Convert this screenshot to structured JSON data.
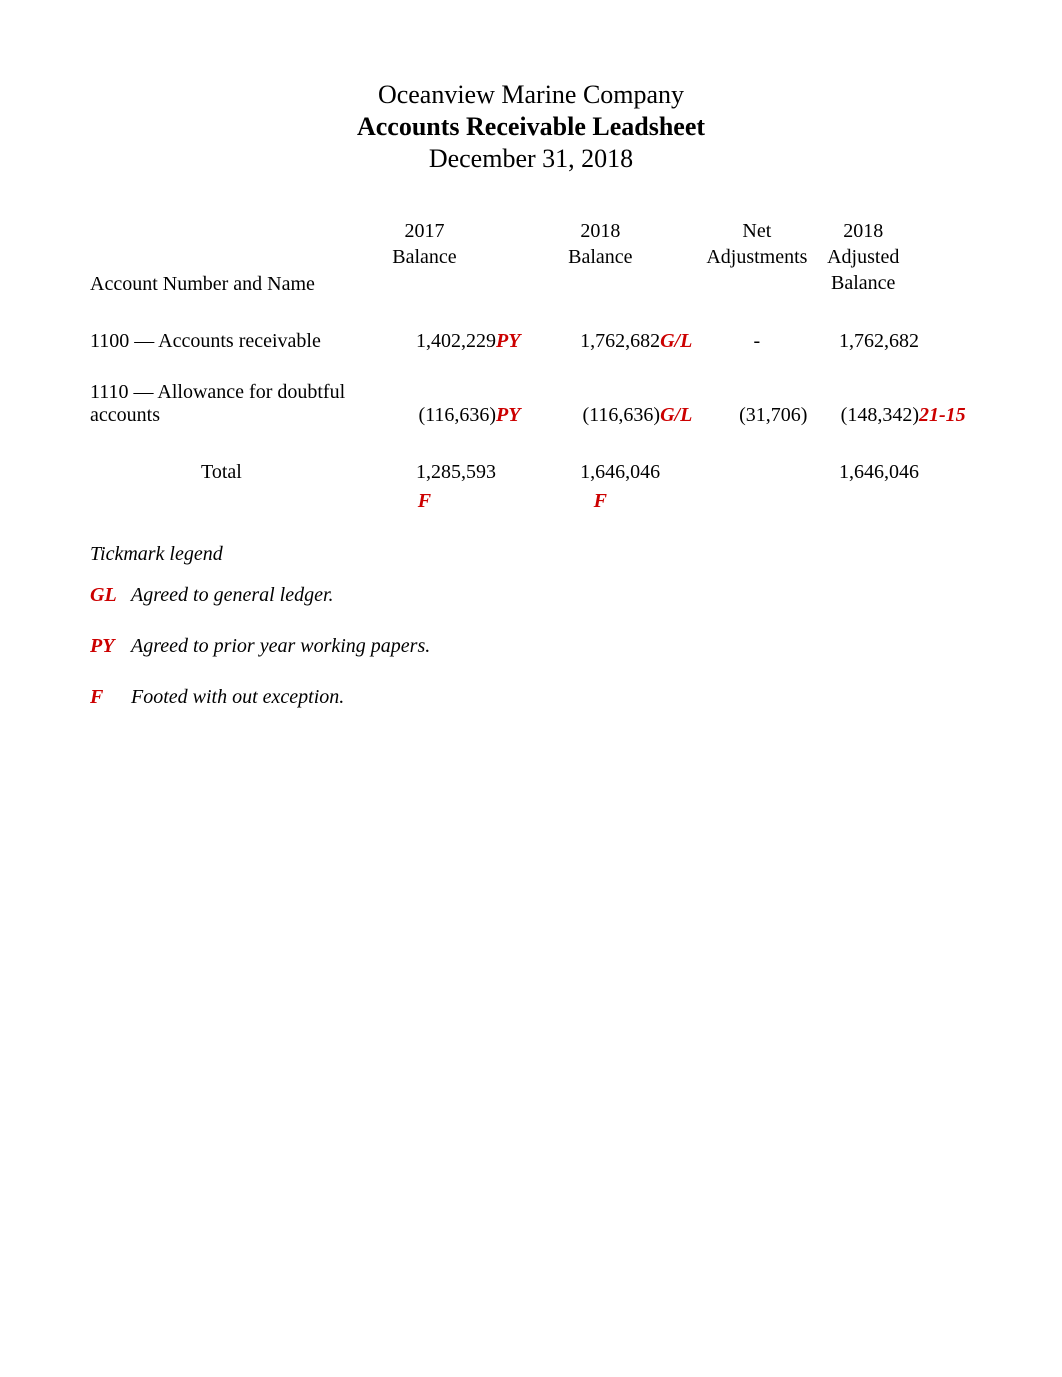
{
  "header": {
    "company": "Oceanview Marine Company",
    "title": "Accounts Receivable Leadsheet",
    "date": "December 31, 2018"
  },
  "columns": {
    "account": "Account Number and Name",
    "bal2017_line1": "2017",
    "bal2017_line2": "Balance",
    "bal2018_line1": "2018",
    "bal2018_line2": "Balance",
    "adj_line1": "Net",
    "adj_line2": "Adjustments",
    "adjbal_line1": "2018",
    "adjbal_line2": "Adjusted",
    "adjbal_line3": "Balance"
  },
  "rows": [
    {
      "name": "1100 — Accounts receivable",
      "bal2017": "1,402,229",
      "tm1": "PY",
      "bal2018": "1,762,682",
      "tm2": "G/L",
      "adj": "-",
      "adjbal": "1,762,682",
      "ref": ""
    },
    {
      "name": "1110 — Allowance for   doubtful accounts",
      "bal2017": "(116,636)",
      "tm1": "PY",
      "bal2018": "(116,636)",
      "tm2": "G/L",
      "adj": "(31,706)",
      "adjbal": "(148,342)",
      "ref": "21-15"
    }
  ],
  "totals": {
    "label": "Total",
    "bal2017": "1,285,593",
    "foot1": "F",
    "bal2018": "1,646,046",
    "foot2": "F",
    "adjbal": "1,646,046"
  },
  "legend": {
    "title": "Tickmark legend",
    "items": [
      {
        "code": "GL",
        "text": "Agreed to general ledger."
      },
      {
        "code": "PY",
        "text": "Agreed to prior year working papers."
      },
      {
        "code": "F",
        "text": "Footed with out exception."
      }
    ]
  },
  "chart_data": {
    "type": "table",
    "title": "Accounts Receivable Leadsheet",
    "columns": [
      "Account Number and Name",
      "2017 Balance",
      "2018 Balance",
      "Net Adjustments",
      "2018 Adjusted Balance"
    ],
    "rows": [
      [
        "1100 — Accounts receivable",
        1402229,
        1762682,
        0,
        1762682
      ],
      [
        "1110 — Allowance for doubtful accounts",
        -116636,
        -116636,
        -31706,
        -148342
      ],
      [
        "Total",
        1285593,
        1646046,
        null,
        1646046
      ]
    ]
  }
}
